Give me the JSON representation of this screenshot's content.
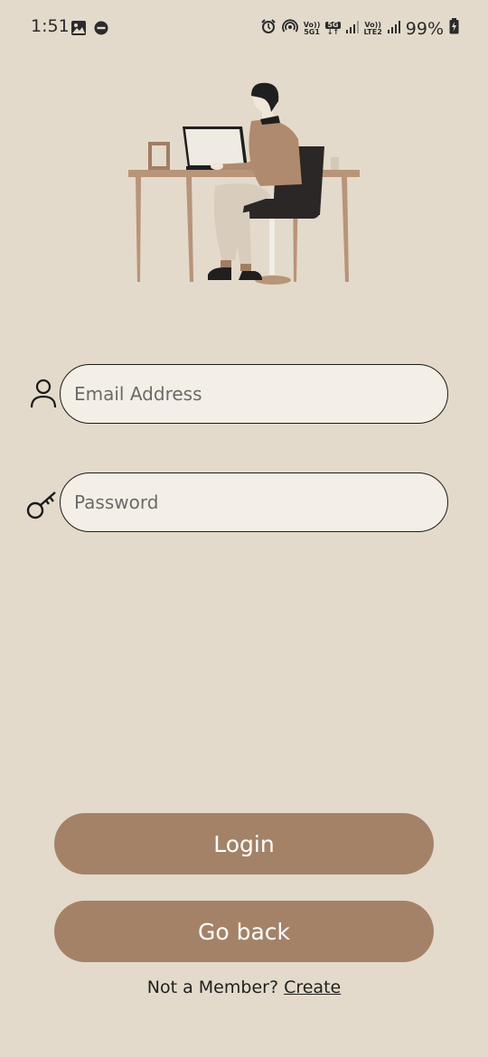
{
  "status_bar": {
    "time": "1:51",
    "network_top": "Vo))",
    "network_5g": "5G",
    "network_bottom": "5G1",
    "network2_top": "Vo))",
    "network2_bottom": "LTE2",
    "battery": "99%",
    "icons": [
      "image-icon",
      "dnd-icon",
      "alarm-icon",
      "hotspot-icon",
      "signal-icon",
      "battery-icon"
    ]
  },
  "illustration": {
    "name": "person-at-desk-illustration"
  },
  "form": {
    "email": {
      "placeholder": "Email Address",
      "value": "",
      "icon": "person-icon"
    },
    "password": {
      "placeholder": "Password",
      "value": "",
      "icon": "key-icon"
    }
  },
  "buttons": {
    "login": "Login",
    "go_back": "Go back"
  },
  "footer": {
    "prompt": "Not a Member?",
    "link": "Create"
  },
  "colors": {
    "background": "#e3dacb",
    "input_bg": "#f4efe6",
    "button": "#a48268",
    "button_text": "#ffffff"
  }
}
